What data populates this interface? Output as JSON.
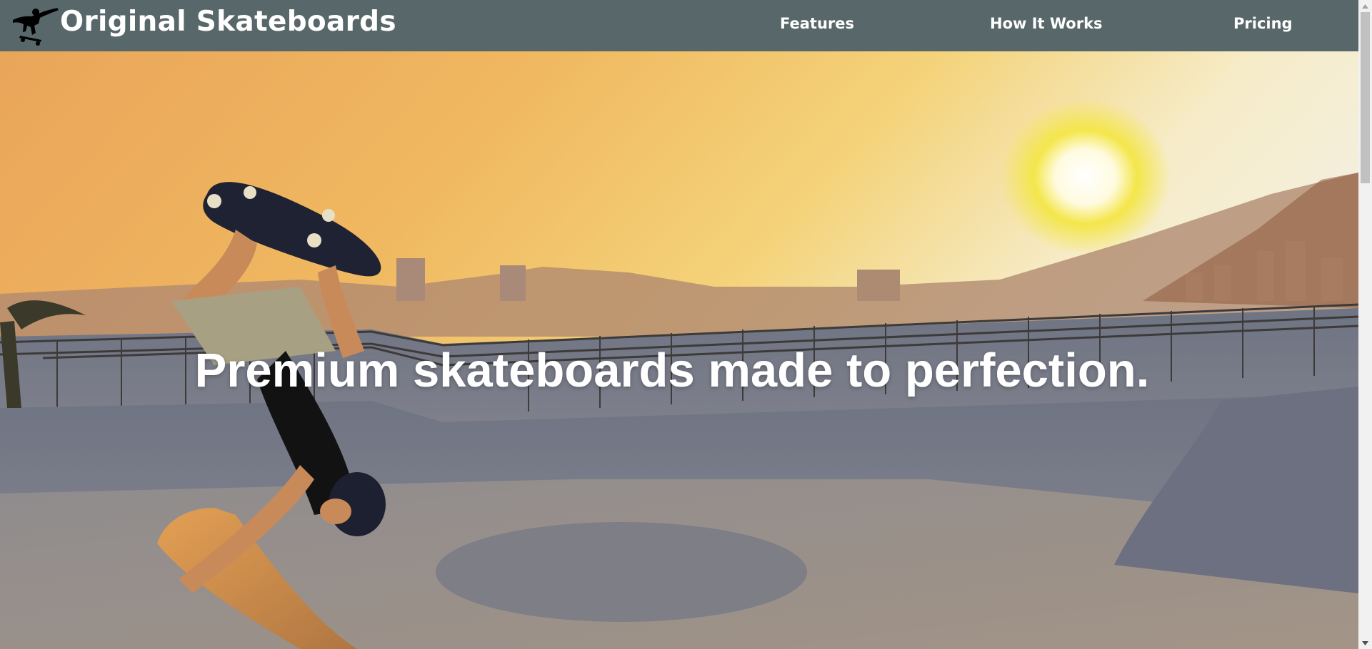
{
  "header": {
    "brand": "Original Skateboards",
    "logo_icon": "skater-silhouette-icon",
    "nav": [
      {
        "label": "Features"
      },
      {
        "label": "How It Works"
      },
      {
        "label": "Pricing"
      }
    ],
    "background_color": "#586769"
  },
  "hero": {
    "headline": "Premium skateboards made to perfection.",
    "image": "skatepark-sunset-skater-photo"
  },
  "scrollbar": {
    "up_icon": "scroll-up-arrow-icon",
    "down_icon": "scroll-down-arrow-icon"
  }
}
